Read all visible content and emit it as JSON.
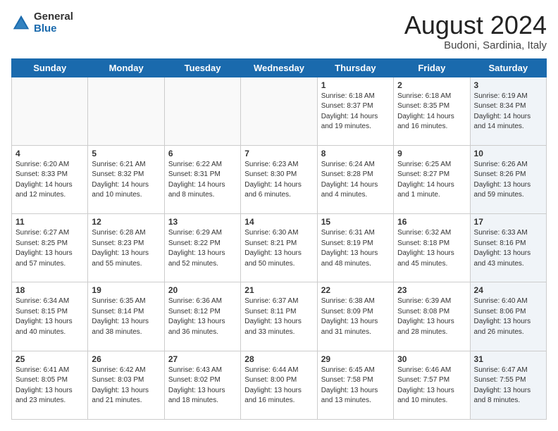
{
  "logo": {
    "general": "General",
    "blue": "Blue"
  },
  "title": "August 2024",
  "location": "Budoni, Sardinia, Italy",
  "days_of_week": [
    "Sunday",
    "Monday",
    "Tuesday",
    "Wednesday",
    "Thursday",
    "Friday",
    "Saturday"
  ],
  "weeks": [
    [
      {
        "day": "",
        "info": ""
      },
      {
        "day": "",
        "info": ""
      },
      {
        "day": "",
        "info": ""
      },
      {
        "day": "",
        "info": ""
      },
      {
        "day": "1",
        "info": "Sunrise: 6:18 AM\nSunset: 8:37 PM\nDaylight: 14 hours\nand 19 minutes."
      },
      {
        "day": "2",
        "info": "Sunrise: 6:18 AM\nSunset: 8:35 PM\nDaylight: 14 hours\nand 16 minutes."
      },
      {
        "day": "3",
        "info": "Sunrise: 6:19 AM\nSunset: 8:34 PM\nDaylight: 14 hours\nand 14 minutes."
      }
    ],
    [
      {
        "day": "4",
        "info": "Sunrise: 6:20 AM\nSunset: 8:33 PM\nDaylight: 14 hours\nand 12 minutes."
      },
      {
        "day": "5",
        "info": "Sunrise: 6:21 AM\nSunset: 8:32 PM\nDaylight: 14 hours\nand 10 minutes."
      },
      {
        "day": "6",
        "info": "Sunrise: 6:22 AM\nSunset: 8:31 PM\nDaylight: 14 hours\nand 8 minutes."
      },
      {
        "day": "7",
        "info": "Sunrise: 6:23 AM\nSunset: 8:30 PM\nDaylight: 14 hours\nand 6 minutes."
      },
      {
        "day": "8",
        "info": "Sunrise: 6:24 AM\nSunset: 8:28 PM\nDaylight: 14 hours\nand 4 minutes."
      },
      {
        "day": "9",
        "info": "Sunrise: 6:25 AM\nSunset: 8:27 PM\nDaylight: 14 hours\nand 1 minute."
      },
      {
        "day": "10",
        "info": "Sunrise: 6:26 AM\nSunset: 8:26 PM\nDaylight: 13 hours\nand 59 minutes."
      }
    ],
    [
      {
        "day": "11",
        "info": "Sunrise: 6:27 AM\nSunset: 8:25 PM\nDaylight: 13 hours\nand 57 minutes."
      },
      {
        "day": "12",
        "info": "Sunrise: 6:28 AM\nSunset: 8:23 PM\nDaylight: 13 hours\nand 55 minutes."
      },
      {
        "day": "13",
        "info": "Sunrise: 6:29 AM\nSunset: 8:22 PM\nDaylight: 13 hours\nand 52 minutes."
      },
      {
        "day": "14",
        "info": "Sunrise: 6:30 AM\nSunset: 8:21 PM\nDaylight: 13 hours\nand 50 minutes."
      },
      {
        "day": "15",
        "info": "Sunrise: 6:31 AM\nSunset: 8:19 PM\nDaylight: 13 hours\nand 48 minutes."
      },
      {
        "day": "16",
        "info": "Sunrise: 6:32 AM\nSunset: 8:18 PM\nDaylight: 13 hours\nand 45 minutes."
      },
      {
        "day": "17",
        "info": "Sunrise: 6:33 AM\nSunset: 8:16 PM\nDaylight: 13 hours\nand 43 minutes."
      }
    ],
    [
      {
        "day": "18",
        "info": "Sunrise: 6:34 AM\nSunset: 8:15 PM\nDaylight: 13 hours\nand 40 minutes."
      },
      {
        "day": "19",
        "info": "Sunrise: 6:35 AM\nSunset: 8:14 PM\nDaylight: 13 hours\nand 38 minutes."
      },
      {
        "day": "20",
        "info": "Sunrise: 6:36 AM\nSunset: 8:12 PM\nDaylight: 13 hours\nand 36 minutes."
      },
      {
        "day": "21",
        "info": "Sunrise: 6:37 AM\nSunset: 8:11 PM\nDaylight: 13 hours\nand 33 minutes."
      },
      {
        "day": "22",
        "info": "Sunrise: 6:38 AM\nSunset: 8:09 PM\nDaylight: 13 hours\nand 31 minutes."
      },
      {
        "day": "23",
        "info": "Sunrise: 6:39 AM\nSunset: 8:08 PM\nDaylight: 13 hours\nand 28 minutes."
      },
      {
        "day": "24",
        "info": "Sunrise: 6:40 AM\nSunset: 8:06 PM\nDaylight: 13 hours\nand 26 minutes."
      }
    ],
    [
      {
        "day": "25",
        "info": "Sunrise: 6:41 AM\nSunset: 8:05 PM\nDaylight: 13 hours\nand 23 minutes."
      },
      {
        "day": "26",
        "info": "Sunrise: 6:42 AM\nSunset: 8:03 PM\nDaylight: 13 hours\nand 21 minutes."
      },
      {
        "day": "27",
        "info": "Sunrise: 6:43 AM\nSunset: 8:02 PM\nDaylight: 13 hours\nand 18 minutes."
      },
      {
        "day": "28",
        "info": "Sunrise: 6:44 AM\nSunset: 8:00 PM\nDaylight: 13 hours\nand 16 minutes."
      },
      {
        "day": "29",
        "info": "Sunrise: 6:45 AM\nSunset: 7:58 PM\nDaylight: 13 hours\nand 13 minutes."
      },
      {
        "day": "30",
        "info": "Sunrise: 6:46 AM\nSunset: 7:57 PM\nDaylight: 13 hours\nand 10 minutes."
      },
      {
        "day": "31",
        "info": "Sunrise: 6:47 AM\nSunset: 7:55 PM\nDaylight: 13 hours\nand 8 minutes."
      }
    ]
  ]
}
